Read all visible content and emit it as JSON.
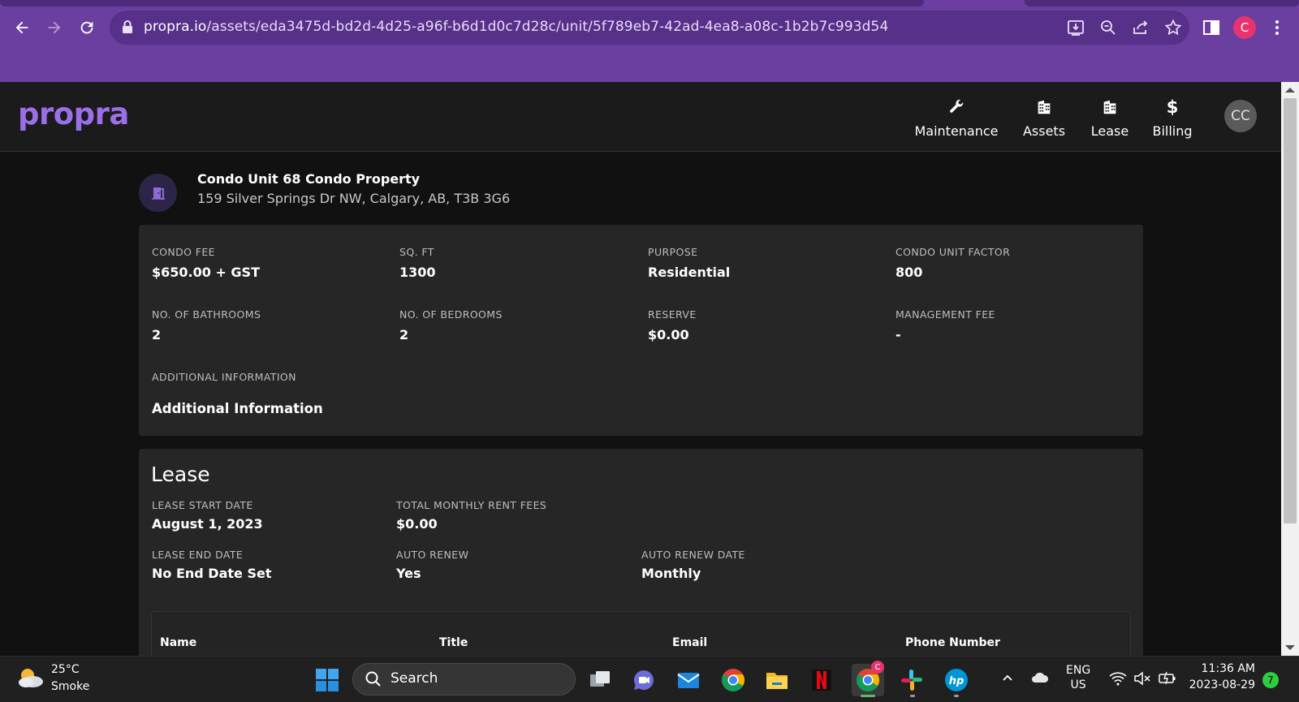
{
  "browser": {
    "url_host": "propra.io",
    "url_path": "/assets/eda3475d-bd2d-4d25-a96f-b6d1d0c7d28c/unit/5f789eb7-42ad-4ea8-a08c-1b2b7c993d54",
    "profile_initial": "C",
    "colors": {
      "frame": "#6a3fa0",
      "omnibox": "#57308a",
      "profile": "#e8336e"
    }
  },
  "app": {
    "logo": "propra",
    "nav": [
      {
        "label": "Maintenance",
        "icon": "wrench-icon"
      },
      {
        "label": "Assets",
        "icon": "building-icon"
      },
      {
        "label": "Lease",
        "icon": "building-icon"
      },
      {
        "label": "Billing",
        "icon": "dollar-icon"
      }
    ],
    "avatar_initials": "CC",
    "colors": {
      "accent": "#9b6fe8",
      "background": "#111111",
      "card": "#262626"
    }
  },
  "unit": {
    "title": "Condo Unit 68 Condo Property",
    "address": "159 Silver Springs Dr NW, Calgary, AB, T3B 3G6",
    "icon": "door-icon"
  },
  "details": {
    "condo_fee": {
      "label": "CONDO FEE",
      "value": "$650.00 + GST"
    },
    "sq_ft": {
      "label": "SQ. FT",
      "value": "1300"
    },
    "purpose": {
      "label": "PURPOSE",
      "value": "Residential"
    },
    "condo_unit_factor": {
      "label": "CONDO UNIT FACTOR",
      "value": "800"
    },
    "bathrooms": {
      "label": "NO. OF BATHROOMS",
      "value": "2"
    },
    "bedrooms": {
      "label": "NO. OF BEDROOMS",
      "value": "2"
    },
    "reserve": {
      "label": "RESERVE",
      "value": "$0.00"
    },
    "management_fee": {
      "label": "MANAGEMENT FEE",
      "value": "-"
    },
    "additional_info": {
      "label": "ADDITIONAL INFORMATION",
      "value": "Additional Information"
    }
  },
  "lease": {
    "heading": "Lease",
    "start_date": {
      "label": "LEASE START DATE",
      "value": "August 1, 2023"
    },
    "total_rent": {
      "label": "TOTAL MONTHLY RENT FEES",
      "value": "$0.00"
    },
    "end_date": {
      "label": "LEASE END DATE",
      "value": "No End Date Set"
    },
    "auto_renew": {
      "label": "AUTO RENEW",
      "value": "Yes"
    },
    "auto_renew_date": {
      "label": "AUTO RENEW DATE",
      "value": "Monthly"
    },
    "contacts_columns": [
      "Name",
      "Title",
      "Email",
      "Phone Number"
    ]
  },
  "taskbar": {
    "weather_temp": "25°C",
    "weather_condition": "Smoke",
    "search_label": "Search",
    "language_line1": "ENG",
    "language_line2": "US",
    "time": "11:36 AM",
    "date": "2023-08-29",
    "notification_count": "7",
    "chrome_badge": "C"
  }
}
